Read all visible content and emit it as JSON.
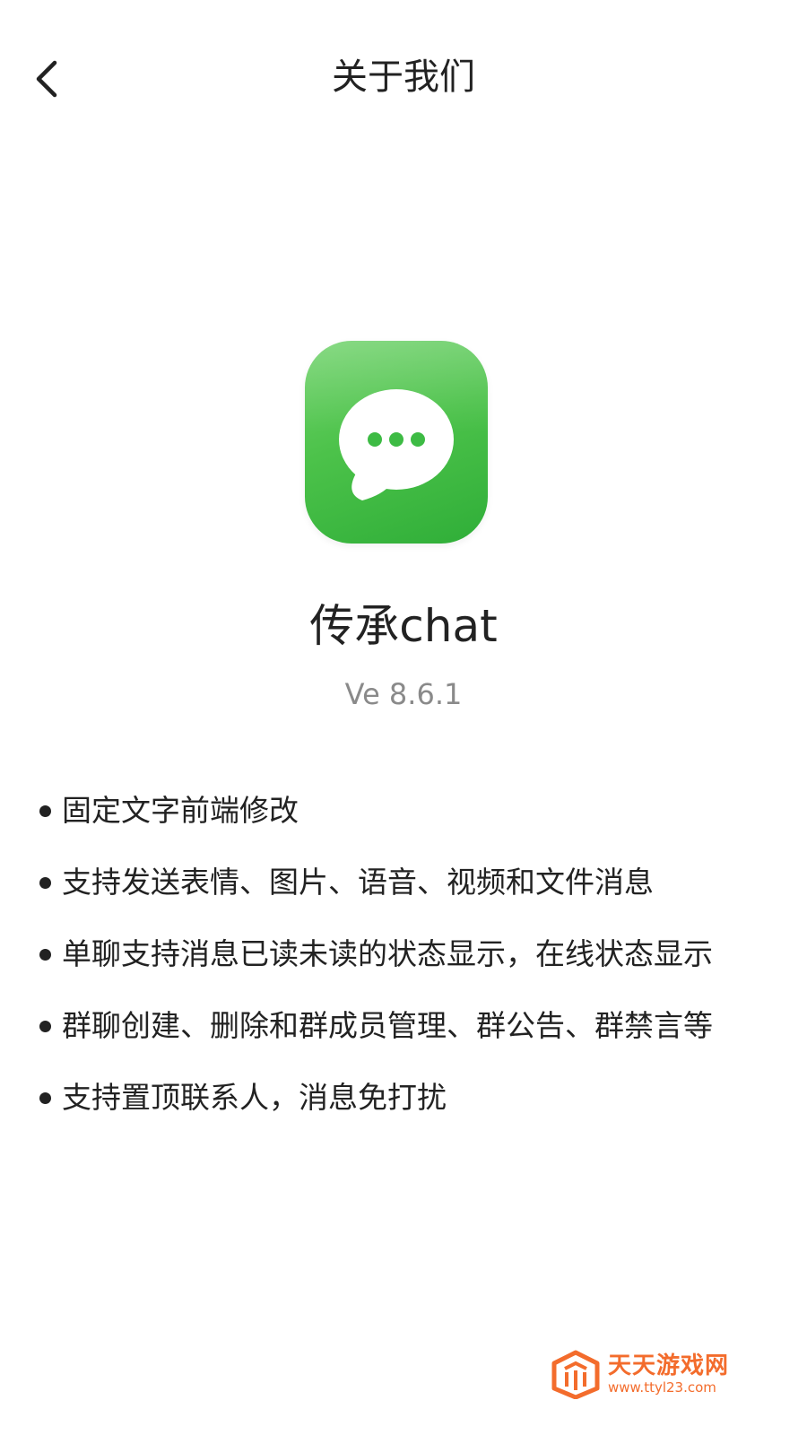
{
  "header": {
    "title": "关于我们",
    "back_icon": "chevron-left-icon"
  },
  "app": {
    "icon": "chat-bubble-icon",
    "name": "传承chat",
    "version": "Ve 8.6.1",
    "colors": {
      "icon_green": "#4cc24a",
      "dots_green": "#3dbb44"
    }
  },
  "features": [
    "固定文字前端修改",
    "支持发送表情、图片、语音、视频和文件消息",
    "单聊支持消息已读未读的状态显示，在线状态显示",
    "群聊创建、删除和群成员管理、群公告、群禁言等",
    "支持置顶联系人，消息免打扰"
  ],
  "watermark": {
    "name": "天天游戏网",
    "url": "www.ttyl23.com",
    "color": "#f36c2c"
  }
}
